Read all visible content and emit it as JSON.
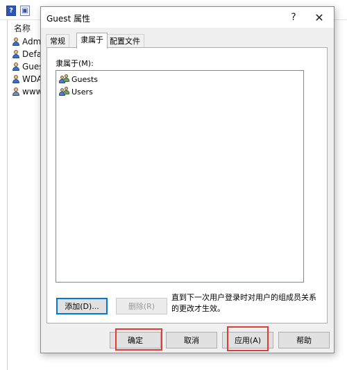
{
  "background": {
    "toolbar": {
      "help_glyph": "?",
      "view_glyph": "▣"
    },
    "list": {
      "header": "名称",
      "items": [
        {
          "label": "Admi",
          "icon": "user-icon"
        },
        {
          "label": "Defau",
          "icon": "user-icon"
        },
        {
          "label": "Gues",
          "icon": "user-icon"
        },
        {
          "label": "WDA",
          "icon": "user-icon"
        },
        {
          "label": "www.",
          "icon": "user-icon"
        }
      ]
    }
  },
  "dialog": {
    "title": "Guest 属性",
    "help_glyph": "?",
    "close_glyph": "✕",
    "tabs": [
      {
        "label": "常规",
        "selected": false
      },
      {
        "label": "隶属于",
        "selected": true
      },
      {
        "label": "配置文件",
        "selected": false
      }
    ],
    "member_of_label": "隶属于(M):",
    "groups": [
      {
        "label": "Guests",
        "icon": "group-icon"
      },
      {
        "label": "Users",
        "icon": "group-icon"
      }
    ],
    "add_label": "添加(D)...",
    "remove_label": "删除(R)",
    "note": "直到下一次用户登录时对用户的组成员关系的更改才生效。",
    "buttons": {
      "ok": "确定",
      "cancel": "取消",
      "apply": "应用(A)",
      "help": "帮助"
    },
    "colors": {
      "highlight": "#e53935",
      "focus_border": "#0078d7"
    }
  }
}
